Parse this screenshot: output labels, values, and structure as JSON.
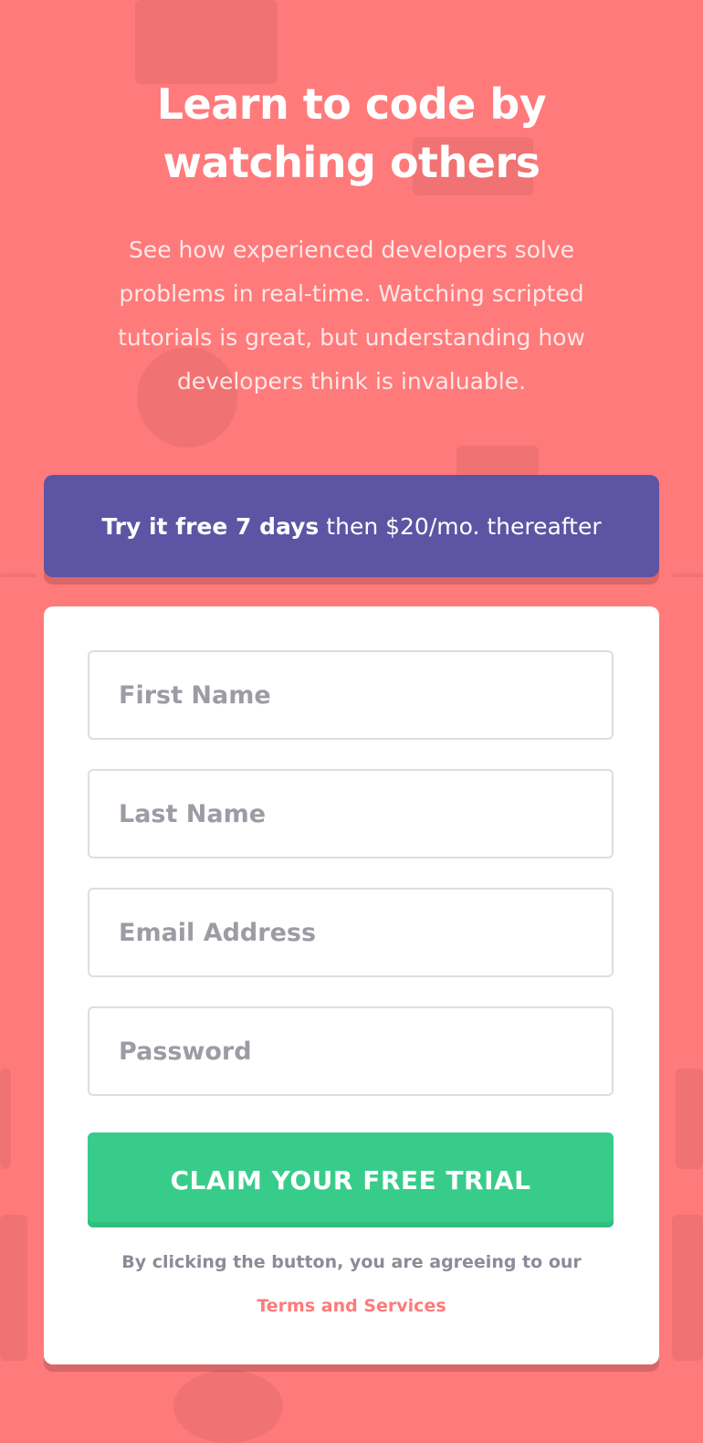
{
  "hero": {
    "title": "Learn to code by watching others",
    "description": "See how experienced developers solve problems in real-time. Watching scripted tutorials is great, but understanding how developers think is invaluable."
  },
  "promo": {
    "bold": "Try it free 7 days",
    "rest": "then $20/mo. thereafter",
    "background": "#5e54a4"
  },
  "form": {
    "first_name_placeholder": "First Name",
    "last_name_placeholder": "Last Name",
    "email_placeholder": "Email Address",
    "password_placeholder": "Password",
    "submit_label": "CLAIM YOUR FREE TRIAL",
    "terms_text": "By clicking the button, you are agreeing to our",
    "terms_link": "Terms and Services"
  },
  "colors": {
    "background": "#ff7a7a",
    "accent_green": "#38cc8b",
    "accent_purple": "#5e54a4"
  }
}
